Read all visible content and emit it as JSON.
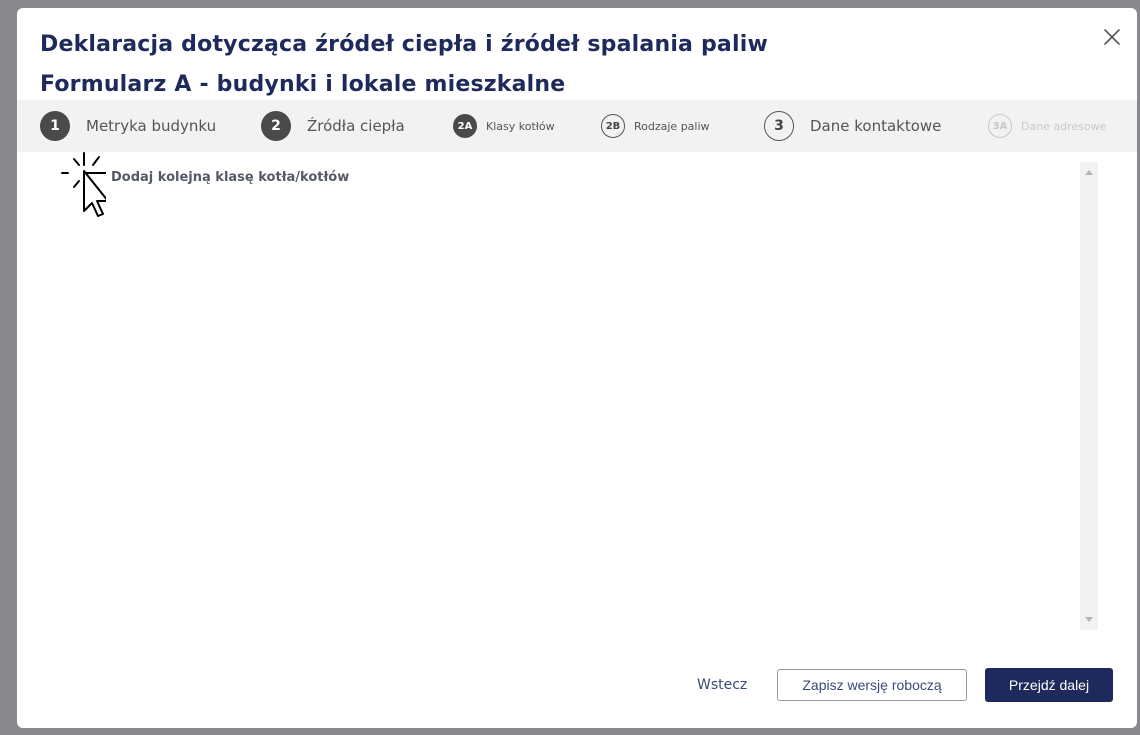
{
  "modal": {
    "title_line1": "Deklaracja dotycząca źródeł ciepła i źródeł spalania paliw",
    "title_line2": "Formularz A - budynki i lokale mieszkalne",
    "close_icon": "close-icon"
  },
  "steps": [
    {
      "number": "1",
      "label": "Metryka budynku",
      "state": "completed"
    },
    {
      "number": "2",
      "label": "Źródła ciepła",
      "state": "completed"
    },
    {
      "number": "2A",
      "label": "Klasy kotłów",
      "state": "active"
    },
    {
      "number": "2B",
      "label": "Rodzaje paliw",
      "state": "upcoming"
    },
    {
      "number": "3",
      "label": "Dane kontaktowe",
      "state": "upcoming"
    },
    {
      "number": "3A",
      "label": "Dane adresowe",
      "state": "disabled"
    }
  ],
  "content": {
    "add_link": "Dodaj kolejną klasę kotła/kotłów"
  },
  "footer": {
    "back_label": "Wstecz",
    "draft_label": "Zapisz wersję roboczą",
    "next_label": "Przejdź dalej"
  },
  "colors": {
    "primary": "#1f2a5c",
    "step_active": "#4a4a4a",
    "stepper_bg": "#f2f2f2",
    "overlay": "#8a8a8e"
  }
}
